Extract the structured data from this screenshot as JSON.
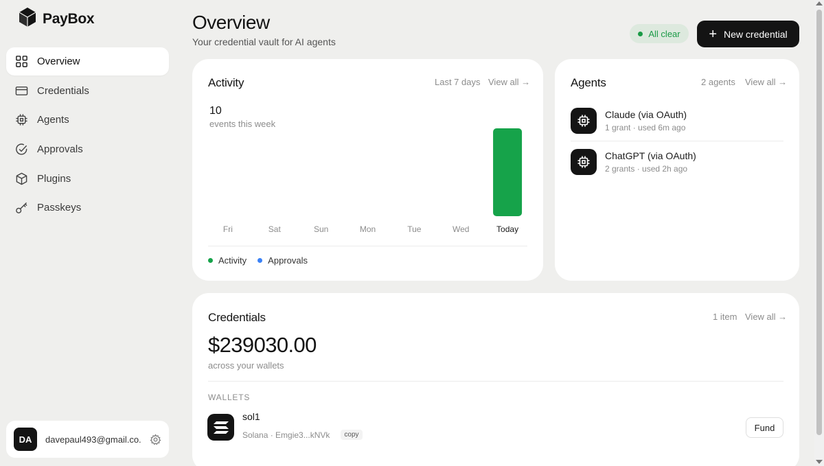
{
  "app": {
    "name": "PayBox"
  },
  "sidebar": {
    "items": [
      {
        "label": "Overview",
        "icon": "grid-icon",
        "active": true
      },
      {
        "label": "Credentials",
        "icon": "card-icon"
      },
      {
        "label": "Agents",
        "icon": "chip-icon"
      },
      {
        "label": "Approvals",
        "icon": "check-circle-icon"
      },
      {
        "label": "Plugins",
        "icon": "box-icon"
      },
      {
        "label": "Passkeys",
        "icon": "key-icon"
      }
    ],
    "user": {
      "initials": "DA",
      "email": "davepaul493@gmail.co..."
    }
  },
  "header": {
    "title": "Overview",
    "subtitle": "Your credential vault for AI agents",
    "status": "All clear",
    "new_button": "New credential"
  },
  "colors": {
    "accent_green": "#16a34a",
    "approvals_blue": "#3b82f6",
    "dark": "#141414",
    "status_bg": "#dde9de"
  },
  "activity": {
    "title": "Activity",
    "range": "Last 7 days",
    "view_all": "View all →",
    "total": "10",
    "total_label": "events this week",
    "legend": [
      {
        "label": "Activity",
        "color": "#16a34a"
      },
      {
        "label": "Approvals",
        "color": "#3b82f6"
      }
    ]
  },
  "chart_data": {
    "type": "bar",
    "categories": [
      "Fri",
      "Sat",
      "Sun",
      "Mon",
      "Tue",
      "Wed",
      "Today"
    ],
    "series": [
      {
        "name": "Activity",
        "values": [
          0,
          0,
          0,
          0,
          0,
          0,
          10
        ]
      },
      {
        "name": "Approvals",
        "values": [
          0,
          0,
          0,
          0,
          0,
          0,
          0
        ]
      }
    ],
    "title": "Activity",
    "xlabel": "",
    "ylabel": "",
    "ylim": [
      0,
      10
    ],
    "grid": false,
    "legend_position": "bottom-left",
    "highlight_category": "Today"
  },
  "agents": {
    "title": "Agents",
    "count": "2 agents",
    "view_all": "View all →",
    "items": [
      {
        "name": "Claude (via OAuth)",
        "detail": "1 grant · used 6m ago"
      },
      {
        "name": "ChatGPT (via OAuth)",
        "detail": "2 grants · used 2h ago"
      }
    ]
  },
  "credentials": {
    "title": "Credentials",
    "count": "1 item",
    "view_all": "View all →",
    "balance": "$239030.00",
    "balance_label": "across your wallets",
    "wallets_label": "WALLETS",
    "wallet": {
      "name": "sol1",
      "detail": "Solana · Emgie3...kNVk",
      "copy": "copy",
      "fund": "Fund"
    }
  }
}
